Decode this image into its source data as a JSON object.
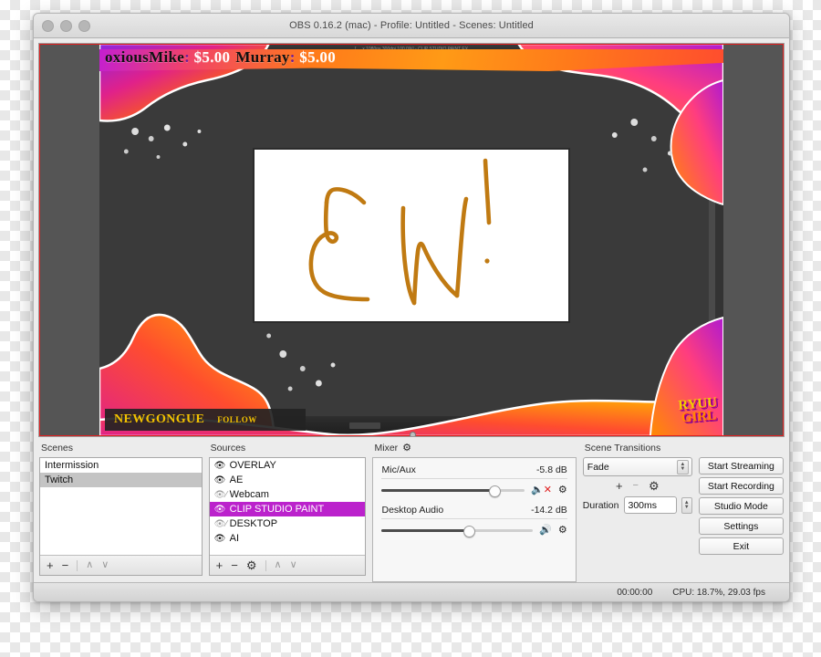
{
  "window": {
    "title": "OBS 0.16.2 (mac) - Profile: Untitled - Scenes: Untitled",
    "traffic_lights": [
      "close",
      "minimize",
      "zoom"
    ]
  },
  "preview": {
    "captured_app_title": "[ ... x 1080px 300dpi 100.0%] - CLIP STUDIO PAINT EX",
    "ticker": {
      "entry_one_name": "oxiousMike",
      "entry_one_amount": "$5.00",
      "entry_two_name": "Murray",
      "entry_two_amount": "$5.00",
      "separator": ":"
    },
    "lower_third": {
      "name": "NEWGONGUE",
      "follow_label": "FOLLOW"
    },
    "logo": {
      "line_one": "RYUU",
      "line_two": "GIRL"
    },
    "canvas_drawing": "EW!"
  },
  "scenes": {
    "title": "Scenes",
    "items": [
      {
        "label": "Intermission",
        "selected": false
      },
      {
        "label": "Twitch",
        "selected": true
      }
    ],
    "toolbar": {
      "add": "+",
      "remove": "−",
      "move_up": "∧",
      "move_down": "∨"
    }
  },
  "sources": {
    "title": "Sources",
    "items": [
      {
        "label": "OVERLAY",
        "visible": true,
        "selected": false
      },
      {
        "label": "AE",
        "visible": true,
        "selected": false
      },
      {
        "label": "Webcam",
        "visible": false,
        "selected": false
      },
      {
        "label": "CLIP STUDIO PAINT",
        "visible": true,
        "selected": true
      },
      {
        "label": "DESKTOP",
        "visible": false,
        "selected": false
      },
      {
        "label": "AI",
        "visible": true,
        "selected": false
      }
    ],
    "toolbar": {
      "add": "+",
      "remove": "−",
      "properties": "⚙",
      "move_up": "∧",
      "move_down": "∨"
    },
    "selected_color": "#bb22cc"
  },
  "mixer": {
    "title": "Mixer",
    "settings_icon": "⚙",
    "channels": [
      {
        "name": "Mic/Aux",
        "level": "-5.8 dB",
        "slider_percent": 78,
        "muted": true,
        "speaker_icon": "muted-speaker-icon",
        "gear_icon": "⚙"
      },
      {
        "name": "Desktop Audio",
        "level": "-14.2 dB",
        "slider_percent": 57,
        "muted": false,
        "speaker_icon": "speaker-icon",
        "gear_icon": "⚙"
      }
    ]
  },
  "transitions": {
    "title": "Scene Transitions",
    "selected": "Fade",
    "options": [
      "Fade"
    ],
    "add": "+",
    "remove": "−",
    "properties": "⚙",
    "duration_label": "Duration",
    "duration_value": "300ms"
  },
  "controls": {
    "start_streaming": "Start Streaming",
    "start_recording": "Start Recording",
    "studio_mode": "Studio Mode",
    "settings": "Settings",
    "exit": "Exit"
  },
  "status": {
    "timecode": "00:00:00",
    "stats": "CPU: 18.7%, 29.03 fps"
  }
}
